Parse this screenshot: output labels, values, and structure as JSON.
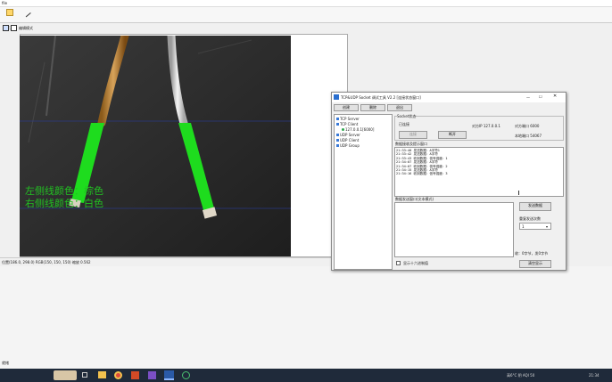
{
  "main": {
    "title_fragment": "file",
    "toolbar": {
      "open_label": "打开",
      "edit_label": "编辑模式"
    },
    "overlay": {
      "left_wire_text": "左侧线颜色：棕色",
      "right_wire_text": "右侧线颜色：白色"
    },
    "status_text": "位置(186.0, 298.0) RGB(150, 150, 150) 缩放 0.562",
    "desktop_text": "就绪"
  },
  "socket_tool": {
    "title": "TCP&UDP Socket 调试工具 V2.2  [连接状态窗口]",
    "buttons": {
      "create": "创建",
      "delete": "删除",
      "exit": "退出"
    },
    "tree": [
      "TCP Server",
      "TCP Client",
      "127.0.0.1[6000]",
      "UDP Server",
      "UDP Client",
      "UDP Group"
    ],
    "status_group_label": "Socket状态",
    "connected_label": "已连接",
    "peer_ip_label": "对方IP 127.0.0.1",
    "peer_port_label": "对方端口 6000",
    "local_port_label": "本地端口 54067",
    "connect_button": "连接",
    "disconnect_button": "断开",
    "recv_label": "数据接收及提示窗口",
    "recv_lines": [
      "21:33:40 发送数据：A字符1",
      "21:33:42 发送数据：A字符",
      "21:33:43 收到数据：信号强度：1",
      "21:34:07 发送数据：A字符",
      "21:34:07 收到数据：信号强度：2",
      "21:34:15 发送数据：A字符",
      "21:34:16 收到数据：信号强度：3"
    ],
    "send_label": "数据发送窗口(文本模式)",
    "send_button": "发送数据",
    "repeat_label": "重复发送次数",
    "repeat_value": "1",
    "stats_text": "收：0字节，发0字节",
    "hex_checkbox_label": "显示十六进制值",
    "clear_button": "清空显示"
  },
  "taskbar": {
    "weather": "高6°C 阴 AQI 50",
    "time": "21:34"
  },
  "colors": {
    "highlight_green": "#1edc1e",
    "overlay_text": "#22c022",
    "taskbar": "#1f2a3a"
  }
}
